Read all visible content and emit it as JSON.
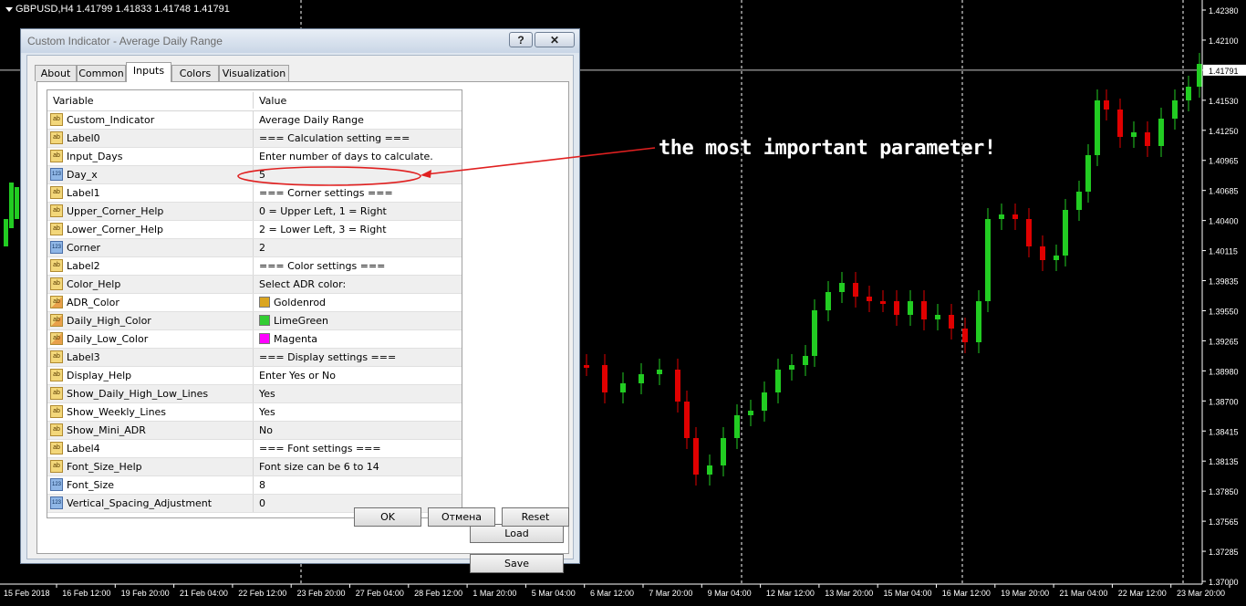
{
  "chart": {
    "symbol_header": "GBPUSD,H4  1.41799 1.41833 1.41748 1.41791",
    "current_price": "1.41791",
    "price_labels": [
      "1.42380",
      "1.42100",
      "1.41791",
      "1.41530",
      "1.41250",
      "1.40965",
      "1.40685",
      "1.40400",
      "1.40115",
      "1.39835",
      "1.39550",
      "1.39265",
      "1.38980",
      "1.38700",
      "1.38415",
      "1.38135",
      "1.37850",
      "1.37565",
      "1.37285",
      "1.37000"
    ],
    "time_labels": [
      "15 Feb 2018",
      "16 Feb 12:00",
      "19 Feb 20:00",
      "21 Feb 04:00",
      "22 Feb 12:00",
      "23 Feb 20:00",
      "27 Feb 04:00",
      "28 Feb 12:00",
      "1 Mar 20:00",
      "5 Mar 04:00",
      "6 Mar 12:00",
      "7 Mar 20:00",
      "9 Mar 04:00",
      "12 Mar 12:00",
      "13 Mar 20:00",
      "15 Mar 04:00",
      "16 Mar 12:00",
      "19 Mar 20:00",
      "21 Mar 04:00",
      "22 Mar 12:00",
      "23 Mar 20:00"
    ],
    "colors": {
      "bull": "#22cc22",
      "bear": "#e00000",
      "background": "#000000",
      "text": "#ffffff"
    }
  },
  "dialog": {
    "title": "Custom Indicator - Average Daily Range",
    "help_label": "?",
    "close_label": "✕",
    "tabs": [
      {
        "label": "About"
      },
      {
        "label": "Common"
      },
      {
        "label": "Inputs"
      },
      {
        "label": "Colors"
      },
      {
        "label": "Visualization"
      }
    ],
    "active_tab": "Inputs",
    "columns": {
      "variable": "Variable",
      "value": "Value"
    },
    "rows": [
      {
        "name": "Custom_Indicator",
        "value": "Average Daily Range",
        "type": "ab"
      },
      {
        "name": "Label0",
        "value": "=== Calculation setting ===",
        "type": "ab"
      },
      {
        "name": "Input_Days",
        "value": "Enter number of days to calculate.",
        "type": "ab"
      },
      {
        "name": "Day_x",
        "value": "5",
        "type": "123"
      },
      {
        "name": "Label1",
        "value": "=== Corner settings ===",
        "type": "ab"
      },
      {
        "name": "Upper_Corner_Help",
        "value": "0 = Upper Left, 1 = Right",
        "type": "ab"
      },
      {
        "name": "Lower_Corner_Help",
        "value": "2 = Lower Left, 3 = Right",
        "type": "ab"
      },
      {
        "name": "Corner",
        "value": "2",
        "type": "123"
      },
      {
        "name": "Label2",
        "value": "=== Color settings ===",
        "type": "ab"
      },
      {
        "name": "Color_Help",
        "value": "Select ADR color:",
        "type": "ab"
      },
      {
        "name": "ADR_Color",
        "value": "Goldenrod",
        "type": "color",
        "swatch": "#daa520"
      },
      {
        "name": "Daily_High_Color",
        "value": "LimeGreen",
        "type": "color",
        "swatch": "#32cd32"
      },
      {
        "name": "Daily_Low_Color",
        "value": "Magenta",
        "type": "color",
        "swatch": "#ff00ff"
      },
      {
        "name": "Label3",
        "value": "=== Display settings ===",
        "type": "ab"
      },
      {
        "name": "Display_Help",
        "value": "Enter Yes or No",
        "type": "ab"
      },
      {
        "name": "Show_Daily_High_Low_Lines",
        "value": "Yes",
        "type": "ab"
      },
      {
        "name": "Show_Weekly_Lines",
        "value": "Yes",
        "type": "ab"
      },
      {
        "name": "Show_Mini_ADR",
        "value": "No",
        "type": "ab"
      },
      {
        "name": "Label4",
        "value": "=== Font settings ===",
        "type": "ab"
      },
      {
        "name": "Font_Size_Help",
        "value": "Font size can be 6 to 14",
        "type": "ab"
      },
      {
        "name": "Font_Size",
        "value": "8",
        "type": "123"
      },
      {
        "name": "Vertical_Spacing_Adjustment",
        "value": "0",
        "type": "123"
      }
    ],
    "icon_labels": {
      "ab": "ab",
      "123": "123",
      "color": "ab"
    },
    "buttons": {
      "load": "Load",
      "save": "Save",
      "ok": "OK",
      "cancel": "Отмена",
      "reset": "Reset"
    }
  },
  "annotation": {
    "text": "the most important parameter!",
    "color": "#e02020"
  }
}
